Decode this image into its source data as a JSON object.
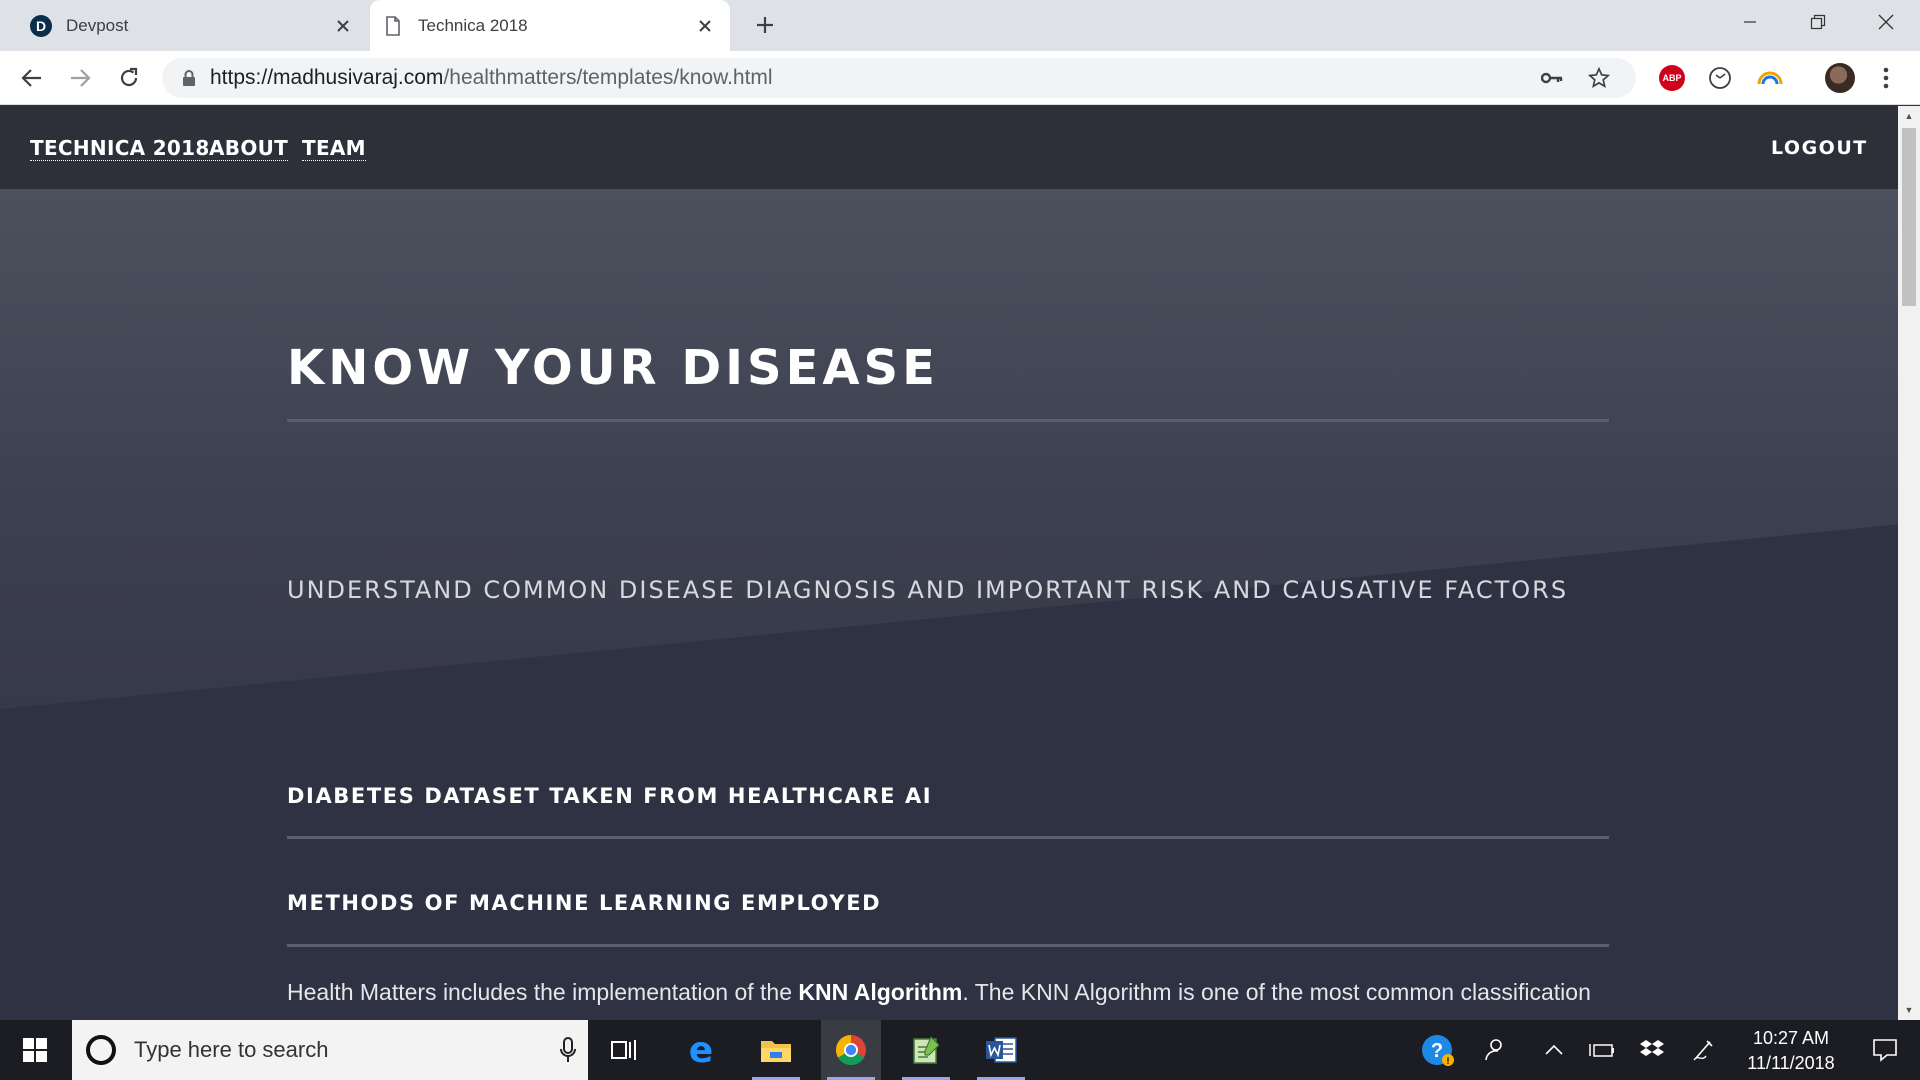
{
  "browser": {
    "tabs": [
      {
        "title": "Devpost",
        "favicon": "devpost-logo"
      },
      {
        "title": "Technica 2018",
        "favicon": "page-icon"
      }
    ],
    "url": {
      "host": "https://madhusivaraj.com",
      "path": "/healthmatters/templates/know.html"
    },
    "extensions": {
      "abp_label": "ABP"
    }
  },
  "site": {
    "nav": {
      "brand": "TECHNICA 2018",
      "about": "ABOUT",
      "team": "TEAM",
      "logout": "LOGOUT"
    },
    "banner": {
      "title": "KNOW YOUR DISEASE",
      "subtitle": "UNDERSTAND COMMON DISEASE DIAGNOSIS AND IMPORTANT RISK AND CAUSATIVE FACTORS"
    },
    "sections": [
      {
        "title": "DIABETES DATASET TAKEN FROM HEALTHCARE AI"
      },
      {
        "title": "METHODS OF MACHINE LEARNING EMPLOYED"
      }
    ],
    "body": {
      "intro": "Health Matters includes the implementation of the ",
      "highlight": "KNN Algorithm",
      "rest": ". The KNN Algorithm is one of the most common classification"
    }
  },
  "taskbar": {
    "search_placeholder": "Type here to search",
    "time": "10:27 AM",
    "date": "11/11/2018"
  },
  "colors": {
    "page_bg": "#2f3242",
    "nav_bg": "#2e3039",
    "banner_top": "#4d515e",
    "taskbar_bg": "#1b1d22"
  }
}
